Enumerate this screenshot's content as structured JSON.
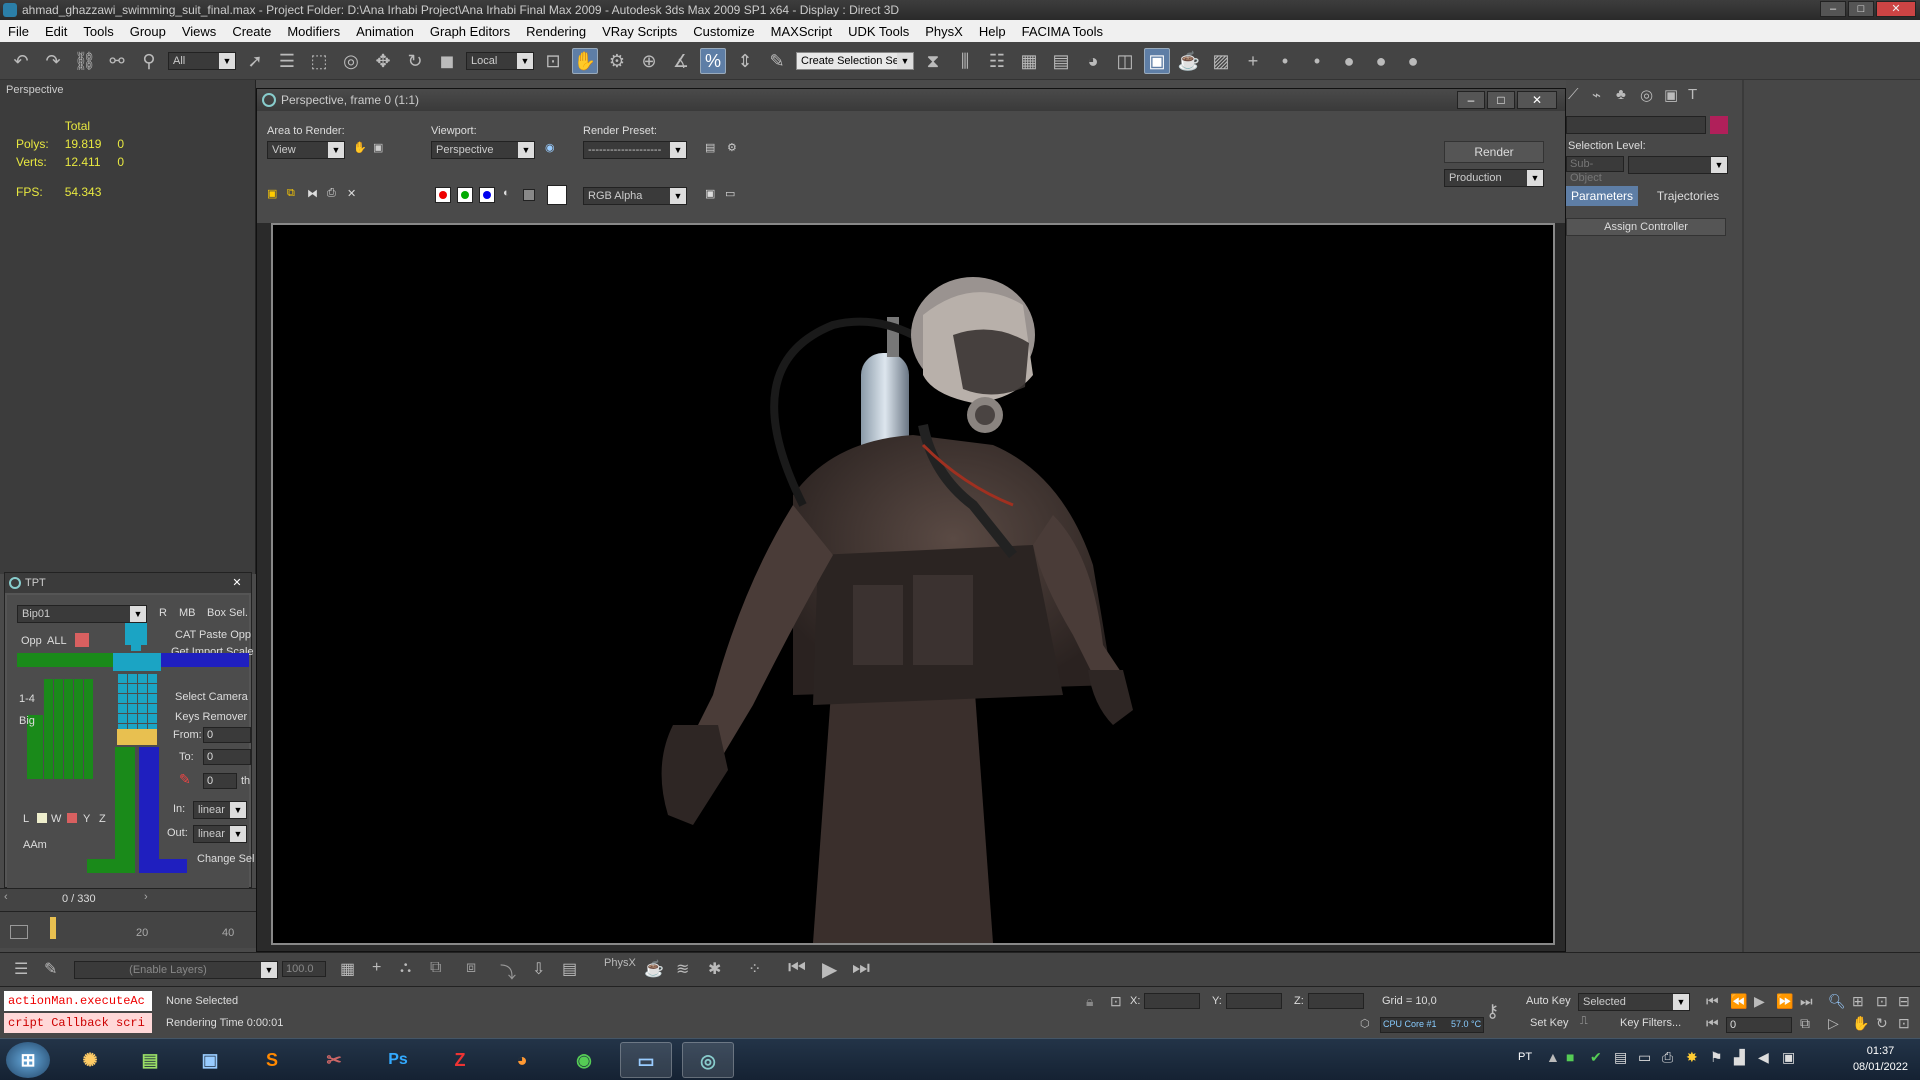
{
  "window": {
    "title": "ahmad_ghazzawi_swimming_suit_final.max    - Project Folder: D:\\Ana Irhabi Project\\Ana Irhabi Final Max 2009    - Autodesk 3ds Max  2009 SP1  x64     - Display : Direct 3D"
  },
  "menu": [
    "File",
    "Edit",
    "Tools",
    "Group",
    "Views",
    "Create",
    "Modifiers",
    "Animation",
    "Graph Editors",
    "Rendering",
    "VRay Scripts",
    "Customize",
    "MAXScript",
    "UDK Tools",
    "PhysX",
    "Help",
    "FACIMA Tools"
  ],
  "toolbar": {
    "selection_filter": "All",
    "ref_coord": "Local",
    "named_selection": "Create Selection Se"
  },
  "viewport": {
    "label": "Perspective",
    "stats": {
      "total_label": "Total",
      "polys_label": "Polys:",
      "polys_total": "19.819",
      "polys_sel": "0",
      "verts_label": "Verts:",
      "verts_total": "12.411",
      "verts_sel": "0",
      "fps_label": "FPS:",
      "fps": "54.343"
    }
  },
  "render_window": {
    "title": "Perspective, frame 0 (1:1)",
    "area_label": "Area to Render:",
    "area_value": "View",
    "viewport_label": "Viewport:",
    "viewport_value": "Perspective",
    "preset_label": "Render Preset:",
    "preset_value": "--------------------",
    "render_button": "Render",
    "production_value": "Production",
    "channel_value": "RGB Alpha"
  },
  "command_panel": {
    "selection_level": "Selection Level:",
    "sub_object": "Sub-Object",
    "parameters_tab": "Parameters",
    "trajectories_tab": "Trajectories",
    "assign_controller": "Assign Controller",
    "accent_color": "#b0205a"
  },
  "tpt": {
    "title": "TPT",
    "bip": "Bip01",
    "r": "R",
    "mb": "MB",
    "box_sel": "Box Sel.",
    "opp": "Opp",
    "all": "ALL",
    "cat_paste": "CAT Paste Opp",
    "get_import": "Get Import Scale",
    "one_four": "1-4",
    "big": "Big",
    "select_camera": "Select Camera",
    "keys_remover": "Keys Remover",
    "from_label": "From:",
    "from_value": "0",
    "to_label": "To:",
    "to_value": "0",
    "th_value": "0",
    "th_label": "th",
    "in_label": "In:",
    "in_value": "linear",
    "out_label": "Out:",
    "out_value": "linear",
    "change_sel": "Change Sel",
    "l": "L",
    "w": "W",
    "yy": "Y",
    "z": "Z",
    "aam": "AAm"
  },
  "timeline": {
    "frame": "0 / 330",
    "tick_20": "20",
    "tick_40": "40"
  },
  "bottom": {
    "layers": "(Enable Layers)",
    "spinner": "100.0",
    "physx": "PhysX",
    "status": "None Selected",
    "rendering_time": "Rendering Time  0:00:01",
    "x_label": "X:",
    "y_label": "Y:",
    "z_label": "Z:",
    "grid": "Grid = 10,0",
    "auto_key": "Auto Key",
    "set_key": "Set Key",
    "selected": "Selected",
    "key_filters": "Key Filters...",
    "frame_value": "0",
    "cpu": "CPU Core #1",
    "temp": "57.0 °C",
    "mxs1": "actionMan.executeAc",
    "mxs2": "cript Callback scri"
  },
  "taskbar": {
    "lang": "PT",
    "time": "01:37",
    "date": "08/01/2022",
    "ps": "Ps"
  }
}
